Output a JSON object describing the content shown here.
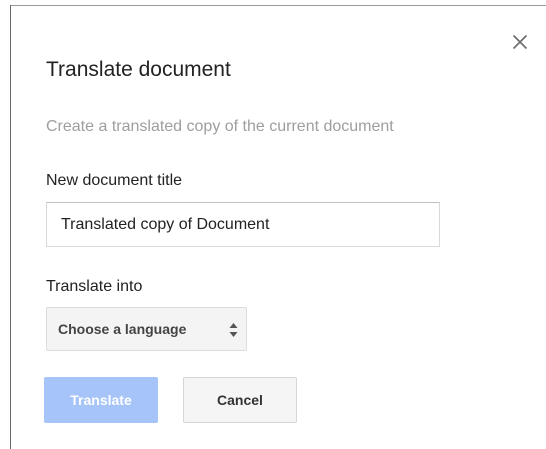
{
  "dialog": {
    "title": "Translate document",
    "subtitle": "Create a translated copy of the current document",
    "close_icon": "close-icon"
  },
  "new_title": {
    "label": "New document title",
    "value": "Translated copy of Document"
  },
  "translate_into": {
    "label": "Translate into",
    "selected": "Choose a language",
    "arrow_icon": "updown-arrows-icon"
  },
  "buttons": {
    "translate_label": "Translate",
    "cancel_label": "Cancel"
  },
  "colors": {
    "translate_disabled_bg": "#a6c4f8",
    "subtitle_text": "#9e9e9e"
  }
}
